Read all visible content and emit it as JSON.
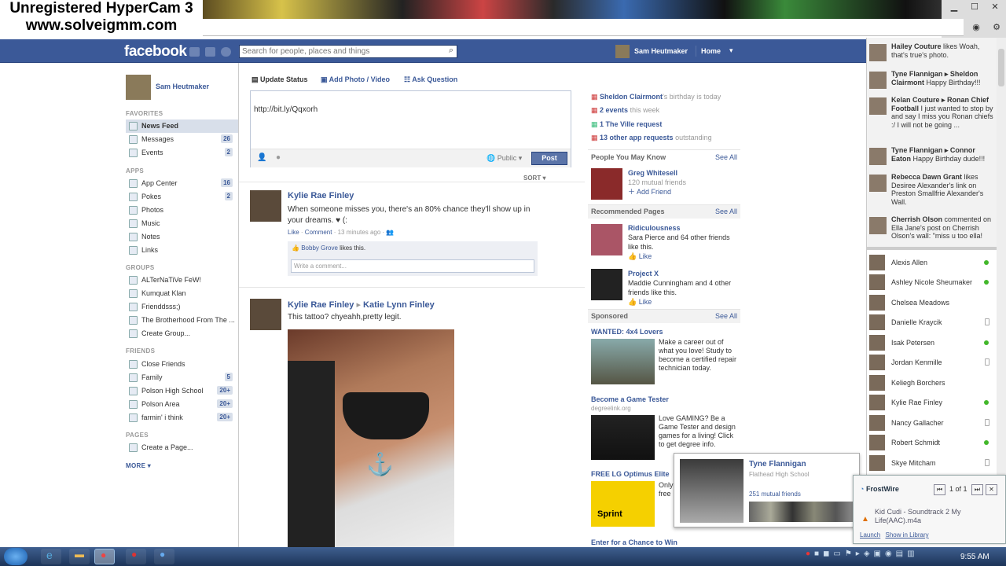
{
  "watermark": {
    "line1": "Unregistered HyperCam 3",
    "line2": "www.solveigmm.com"
  },
  "header": {
    "logo": "facebook",
    "search_placeholder": "Search for people, places and things",
    "user": "Sam Heutmaker",
    "home": "Home"
  },
  "left": {
    "profile_name": "Sam Heutmaker",
    "favorites_label": "FAVORITES",
    "favorites": [
      {
        "label": "News Feed",
        "count": ""
      },
      {
        "label": "Messages",
        "count": "26"
      },
      {
        "label": "Events",
        "count": "2"
      }
    ],
    "apps_label": "APPS",
    "apps": [
      {
        "label": "App Center",
        "count": "16"
      },
      {
        "label": "Pokes",
        "count": "2"
      },
      {
        "label": "Photos",
        "count": ""
      },
      {
        "label": "Music",
        "count": ""
      },
      {
        "label": "Notes",
        "count": ""
      },
      {
        "label": "Links",
        "count": ""
      }
    ],
    "groups_label": "GROUPS",
    "groups": [
      {
        "label": "ALTerNaTiVe FeW!"
      },
      {
        "label": "Kumquat Klan"
      },
      {
        "label": "Frienddsss;)"
      },
      {
        "label": "The Brotherhood From The ..."
      },
      {
        "label": "Create Group..."
      }
    ],
    "friends_label": "FRIENDS",
    "friends": [
      {
        "label": "Close Friends",
        "count": ""
      },
      {
        "label": "Family",
        "count": "5"
      },
      {
        "label": "Polson High School",
        "count": "20+"
      },
      {
        "label": "Polson Area",
        "count": "20+"
      },
      {
        "label": "farmin' i think",
        "count": "20+"
      }
    ],
    "pages_label": "PAGES",
    "create_page": "Create a Page...",
    "more": "MORE"
  },
  "composer": {
    "tabs": [
      "Update Status",
      "Add Photo / Video",
      "Ask Question"
    ],
    "text": "http://bit.ly/Qqxorh",
    "privacy": "Public",
    "post": "Post",
    "sort": "SORT"
  },
  "posts": [
    {
      "author": "Kylie Rae Finley",
      "text": "When someone misses you, there's an 80% chance they'll show up in your dreams. ♥ (:",
      "like": "Like",
      "comment": "Comment",
      "time": "13 minutes ago",
      "liker": "Bobby Grove",
      "likes_suffix": "likes this.",
      "comment_placeholder": "Write a comment..."
    },
    {
      "author": "Kylie Rae Finley",
      "target": "Katie Lynn Finley",
      "text": "This tattoo? chyeahh,pretty legit."
    }
  ],
  "right": {
    "reminders": [
      {
        "bold": "Sheldon Clairmont",
        "rest": "'s birthday is today"
      },
      {
        "bold": "2 events",
        "rest": " this week"
      },
      {
        "bold": "1 The Ville request",
        "rest": ""
      },
      {
        "bold": "13 other app requests",
        "rest": " outstanding"
      }
    ],
    "pymk_title": "People You May Know",
    "see_all": "See All",
    "pymk": {
      "name": "Greg Whitesell",
      "mutual": "120 mutual friends",
      "add": "Add Friend"
    },
    "rec_title": "Recommended Pages",
    "rec": [
      {
        "name": "Ridiculousness",
        "line": "Sara Pierce and 64 other friends like this.",
        "like": "Like"
      },
      {
        "name": "Project X",
        "line": "Maddie Cunningham and 4 other friends like this.",
        "like": "Like"
      }
    ],
    "sponsored_title": "Sponsored",
    "ads": [
      {
        "title": "WANTED: 4x4 Lovers",
        "sub": "",
        "text": "Make a career out of what you love! Study to become a certified repair technician today."
      },
      {
        "title": "Become a Game Tester",
        "sub": "degreelink.org",
        "text": "Love GAMING? Be a Game Tester and design games for a living! Click to get degree info."
      },
      {
        "title": "FREE LG Optimus Elite",
        "sub": "",
        "text": "Only free"
      },
      {
        "title": "Enter for a Chance to Win",
        "sub": "",
        "text": ""
      }
    ]
  },
  "hover_card": {
    "name": "Tyne Flannigan",
    "school": "Flathead High School",
    "mutual": "251 mutual friends"
  },
  "ticker": [
    {
      "bold": "Hailey Couture",
      "text": " likes Woah, that's true's photo."
    },
    {
      "bold": "Tyne Flannigan ▸ Sheldon Clairmont",
      "text": " Happy Birthday!!!"
    },
    {
      "bold": "Kelan Couture ▸ Ronan Chief Football",
      "text": " I just wanted to stop by and say I miss you Ronan chiefs :/ I will not be going ..."
    },
    {
      "bold": "Tyne Flannigan ▸ Connor Eaton",
      "text": " Happy Birthday dude!!!"
    },
    {
      "bold": "Rebecca Dawn Grant",
      "text": " likes Desiree Alexander's link on Preston Smallfrie Alexander's Wall."
    },
    {
      "bold": "Cherrish Olson",
      "text": " commented on Ella Jane's post on Cherrish Olson's wall: \"miss u too ella!"
    }
  ],
  "chat": [
    {
      "name": "Alexis Allen",
      "status": "online"
    },
    {
      "name": "Ashley Nicole Sheumaker",
      "status": "online"
    },
    {
      "name": "Chelsea Meadows",
      "status": ""
    },
    {
      "name": "Danielle Kraycik",
      "status": "mobile"
    },
    {
      "name": "Isak Petersen",
      "status": "online"
    },
    {
      "name": "Jordan Kenmille",
      "status": "mobile"
    },
    {
      "name": "Keliegh Borchers",
      "status": ""
    },
    {
      "name": "Kylie Rae Finley",
      "status": "online"
    },
    {
      "name": "Nancy Gallacher",
      "status": "mobile"
    },
    {
      "name": "Robert Schmidt",
      "status": "online"
    },
    {
      "name": "Skye Mitcham",
      "status": "mobile"
    }
  ],
  "frostwire": {
    "title": "FrostWire",
    "counter": "1 of 1",
    "track": "Kid Cudi - Soundtrack 2 My Life(AAC).m4a",
    "launch": "Launch",
    "show": "Show in Library"
  },
  "taskbar": {
    "clock": "9:55 AM"
  }
}
